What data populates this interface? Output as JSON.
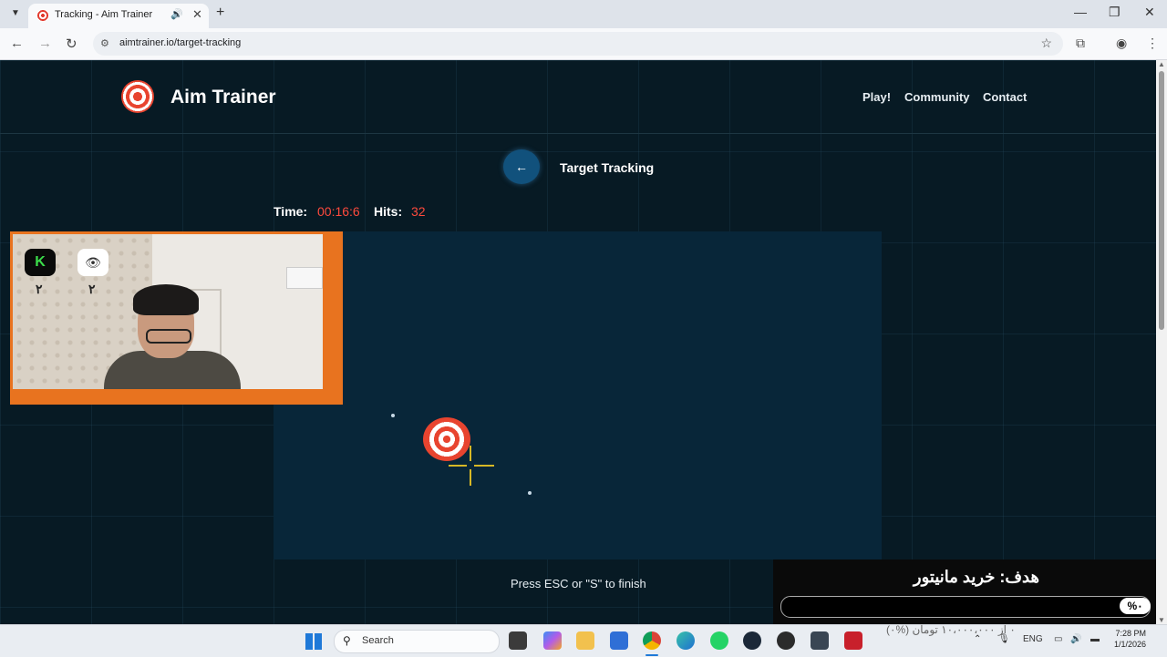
{
  "browser": {
    "tab_title": "Tracking - Aim Trainer",
    "url": "aimtrainer.io/target-tracking",
    "icons": {
      "tab_menu": "chevron-down-icon",
      "audio": "speaker-icon",
      "close": "close-icon",
      "new_tab": "plus-icon",
      "back": "arrow-left-icon",
      "forward": "arrow-right-icon",
      "reload": "reload-icon",
      "site_info": "tune-icon",
      "bookmark": "star-icon",
      "extensions": "puzzle-icon",
      "profile": "account-icon",
      "menu": "kebab-menu-icon"
    }
  },
  "site": {
    "logo_text": "Aim Trainer",
    "nav": [
      "Play!",
      "Community",
      "Contact"
    ]
  },
  "game": {
    "back_button_icon": "arrow-left-icon",
    "title": "Target Tracking",
    "time_label": "Time:",
    "time_value": "00:16:6",
    "hits_label": "Hits:",
    "hits_value": "32",
    "hint": "Press ESC or \"S\" to finish"
  },
  "webcam": {
    "badge_k": "K",
    "badge_k_count": "۲",
    "badge_eye_icon": "eye-icon",
    "badge_eye_count": "۲"
  },
  "goal": {
    "title": "هدف: خرید مانیتور",
    "percent": "%۰",
    "subtitle": "۰ از ۱۰،۰۰۰،۰۰۰ تومان (%۰)"
  },
  "taskbar": {
    "search_placeholder": "Search",
    "tray_lang": "ENG",
    "time": "7:28 PM",
    "date": "1/1/2026"
  },
  "colors": {
    "page_bg": "#071a24",
    "arena_bg": "#082639",
    "accent_red": "#ff4a3d",
    "cam_frame": "#e8731f",
    "crosshair": "#d7b825",
    "back_button": "#11517c"
  }
}
